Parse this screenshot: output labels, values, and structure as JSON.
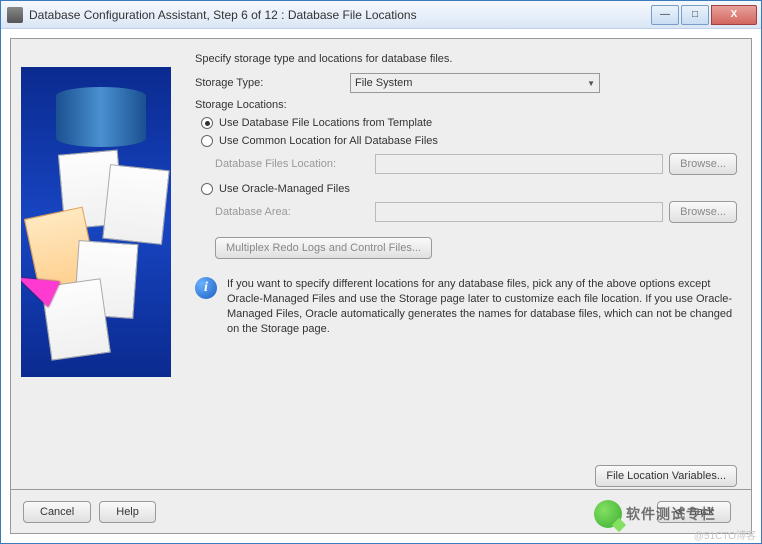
{
  "window": {
    "title": "Database Configuration Assistant, Step 6 of 12 : Database File Locations"
  },
  "form": {
    "intro": "Specify storage type and locations for database files.",
    "storage_type_label": "Storage Type:",
    "storage_type_value": "File System",
    "storage_locations_label": "Storage Locations:",
    "radio1": "Use Database File Locations from Template",
    "radio2": "Use Common Location for All Database Files",
    "db_files_loc_label": "Database Files Location:",
    "db_files_loc_value": "",
    "browse1": "Browse...",
    "radio3": "Use Oracle-Managed Files",
    "db_area_label": "Database Area:",
    "db_area_value": "",
    "browse2": "Browse...",
    "multiplex_btn": "Multiplex Redo Logs and Control Files...",
    "info_text": "If you want to specify different locations for any database files, pick any of the above options except Oracle-Managed Files and use the Storage page later to customize each file location. If you use Oracle-Managed Files, Oracle automatically generates the names for database files, which can not be changed on the Storage page.",
    "loc_var_btn": "File Location Variables..."
  },
  "buttons": {
    "cancel": "Cancel",
    "help": "Help",
    "back": "Back"
  },
  "watermark": {
    "text": "软件测试专栏",
    "footer": "@51CTO博客"
  }
}
